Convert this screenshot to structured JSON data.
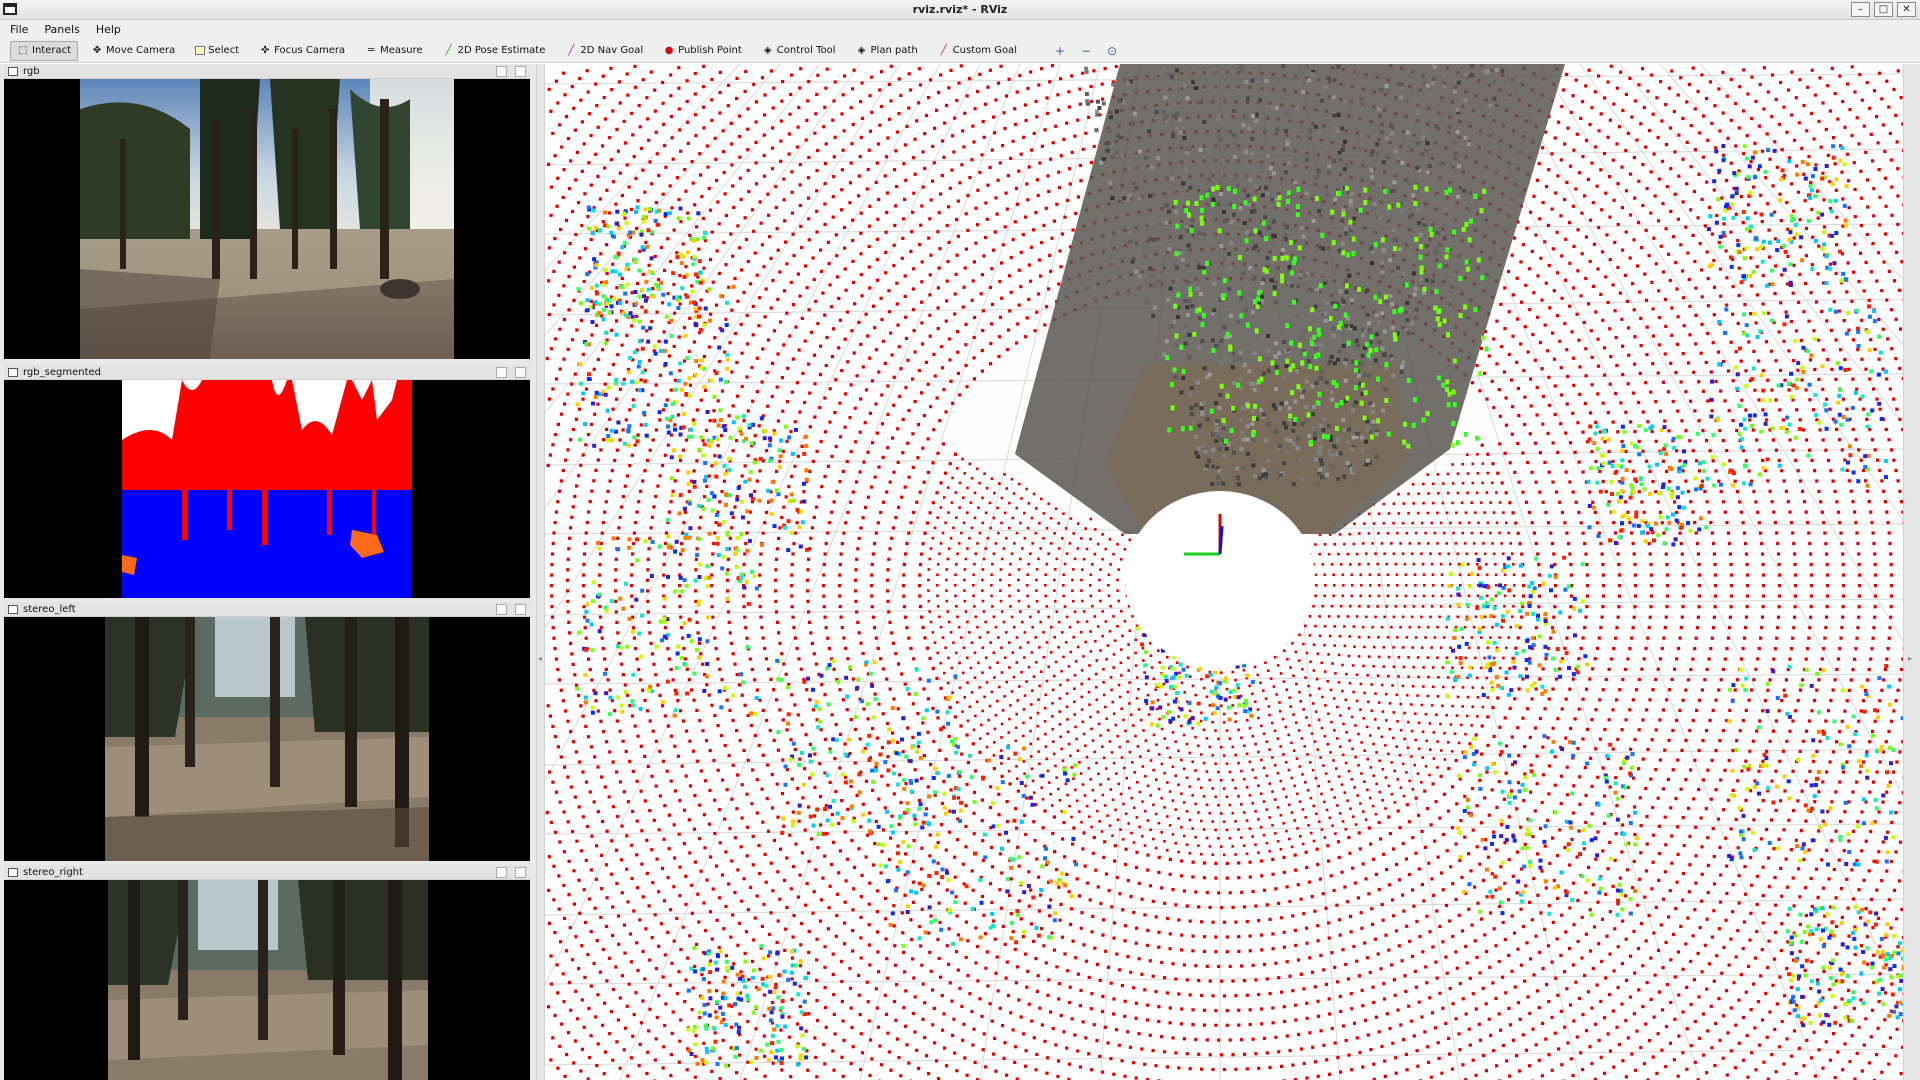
{
  "window": {
    "title": "rviz.rviz* - RViz",
    "buttons": [
      "–",
      "□",
      "✕"
    ]
  },
  "menu": [
    "File",
    "Panels",
    "Help"
  ],
  "toolbar": {
    "tools": [
      {
        "label": "Interact",
        "icon": "interact-icon",
        "active": true
      },
      {
        "label": "Move Camera",
        "icon": "move-camera-icon",
        "active": false
      },
      {
        "label": "Select",
        "icon": "select-icon",
        "active": false
      },
      {
        "label": "Focus Camera",
        "icon": "focus-camera-icon",
        "active": false
      },
      {
        "label": "Measure",
        "icon": "measure-icon",
        "active": false
      },
      {
        "label": "2D Pose Estimate",
        "icon": "pose-estimate-icon",
        "active": false
      },
      {
        "label": "2D Nav Goal",
        "icon": "nav-goal-icon",
        "active": false
      },
      {
        "label": "Publish Point",
        "icon": "publish-point-icon",
        "active": false
      },
      {
        "label": "Control Tool",
        "icon": "control-tool-icon",
        "active": false
      },
      {
        "label": "Plan path",
        "icon": "plan-path-icon",
        "active": false
      },
      {
        "label": "Custom Goal",
        "icon": "custom-goal-icon",
        "active": false
      }
    ],
    "zoom": [
      "+",
      "−",
      "⊙"
    ]
  },
  "panels": [
    {
      "name": "rgb",
      "type": "forest"
    },
    {
      "name": "rgb_segmented",
      "type": "segmented"
    },
    {
      "name": "stereo_left",
      "type": "forest-dark"
    },
    {
      "name": "stereo_right",
      "type": "forest-dark"
    }
  ],
  "colors": {
    "accent_red": "#e00000",
    "segment_red": "#ff0000",
    "segment_blue": "#0000ff",
    "segment_orange": "#ff6a1a",
    "grid": "#d9d9d9"
  }
}
